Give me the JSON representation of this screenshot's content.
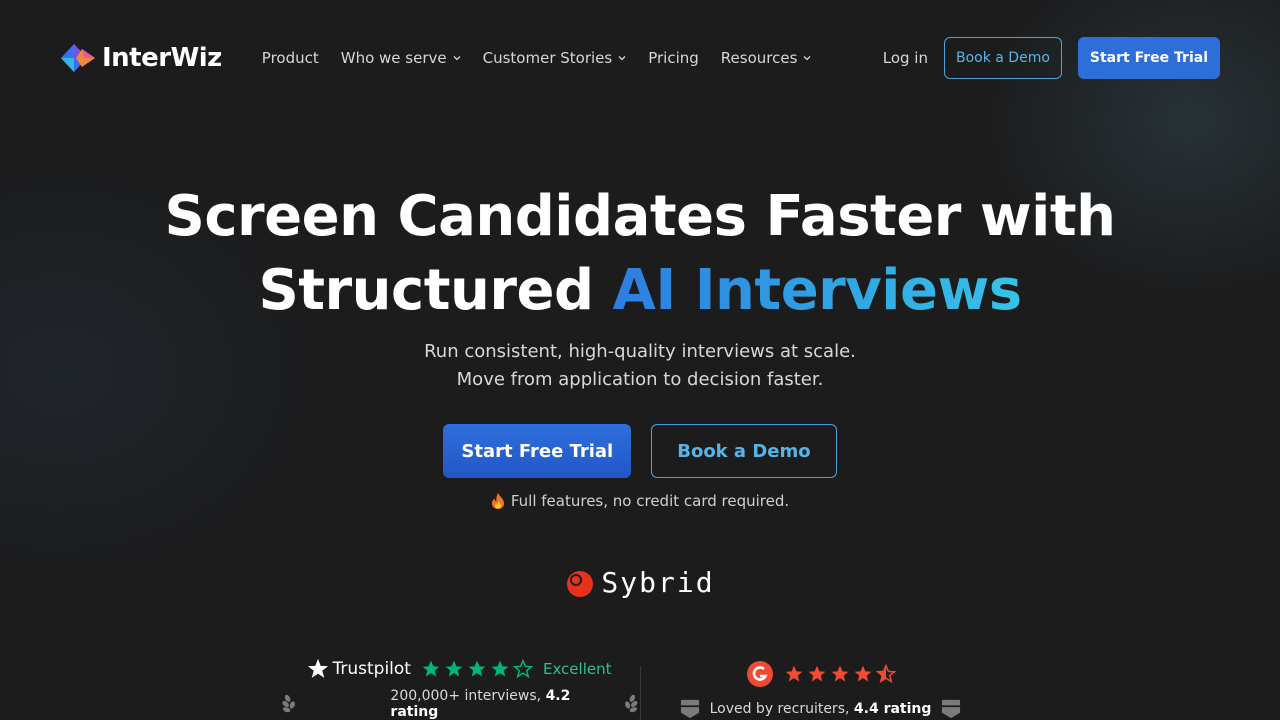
{
  "nav": {
    "brand": "InterWiz",
    "links": [
      {
        "label": "Product",
        "has_dropdown": false
      },
      {
        "label": "Who we serve",
        "has_dropdown": true
      },
      {
        "label": "Customer Stories",
        "has_dropdown": true
      },
      {
        "label": "Pricing",
        "has_dropdown": false
      },
      {
        "label": "Resources",
        "has_dropdown": true
      }
    ],
    "login": "Log in",
    "book_demo": "Book a Demo",
    "start_trial": "Start Free Trial"
  },
  "hero": {
    "title_line1": "Screen Candidates Faster with",
    "title_line2_plain": "Structured ",
    "title_line2_accent": "AI Interviews",
    "subtitle_line1": "Run consistent, high-quality interviews at scale.",
    "subtitle_line2": "Move from application to decision faster.",
    "cta_primary": "Start Free Trial",
    "cta_secondary": "Book a Demo",
    "note": "Full features, no credit card required."
  },
  "client_logo": "Sybrid",
  "ratings": {
    "trustpilot": {
      "brand": "Trustpilot",
      "label": "Excellent",
      "stars_filled": 4,
      "summary_prefix": "200,000+ interviews, ",
      "summary_bold": "4.2 rating"
    },
    "g2": {
      "stars_value": 4.5,
      "summary_prefix": "Loved by recruiters, ",
      "summary_bold": "4.4 rating"
    }
  },
  "colors": {
    "background": "#1c1c1d",
    "accent_blue": "#2d6ed8",
    "accent_cyan": "#35c4e8",
    "trustpilot_green": "#00b67a",
    "g2_red": "#ef4b34"
  }
}
